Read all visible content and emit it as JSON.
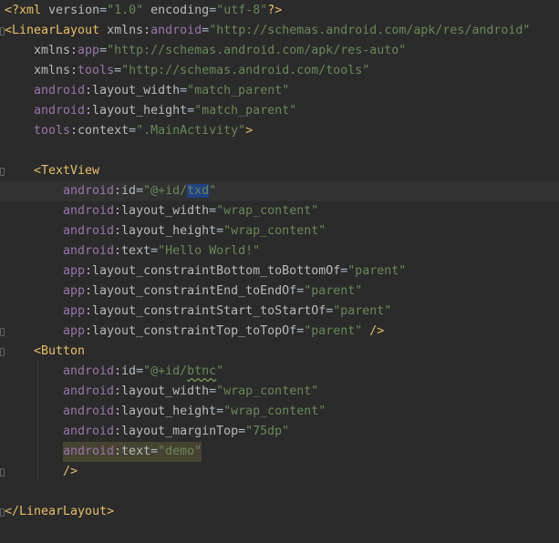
{
  "lines": [
    {
      "indent": 0,
      "tokens": [
        {
          "t": "<?",
          "k": "punc"
        },
        {
          "t": "xml ",
          "k": "tag"
        },
        {
          "t": "version",
          "k": "attr"
        },
        {
          "t": "=",
          "k": "eq"
        },
        {
          "t": "\"1.0\"",
          "k": "str"
        },
        {
          "t": " encoding",
          "k": "attr"
        },
        {
          "t": "=",
          "k": "eq"
        },
        {
          "t": "\"utf-8\"",
          "k": "str"
        },
        {
          "t": "?>",
          "k": "punc"
        }
      ]
    },
    {
      "indent": 0,
      "fold": true,
      "tokens": [
        {
          "t": "<LinearLayout ",
          "k": "tag"
        },
        {
          "t": "xmlns",
          "k": "attr"
        },
        {
          "t": ":",
          "k": "attr"
        },
        {
          "t": "android",
          "k": "ns"
        },
        {
          "t": "=",
          "k": "eq"
        },
        {
          "t": "\"http://schemas.android.com/apk/res/android\"",
          "k": "str"
        }
      ]
    },
    {
      "indent": 1,
      "tokens": [
        {
          "t": "xmlns",
          "k": "attr"
        },
        {
          "t": ":",
          "k": "attr"
        },
        {
          "t": "app",
          "k": "ns"
        },
        {
          "t": "=",
          "k": "eq"
        },
        {
          "t": "\"http://schemas.android.com/apk/res-auto\"",
          "k": "str"
        }
      ]
    },
    {
      "indent": 1,
      "tokens": [
        {
          "t": "xmlns",
          "k": "attr"
        },
        {
          "t": ":",
          "k": "attr"
        },
        {
          "t": "tools",
          "k": "ns"
        },
        {
          "t": "=",
          "k": "eq"
        },
        {
          "t": "\"http://schemas.android.com/tools\"",
          "k": "str"
        }
      ]
    },
    {
      "indent": 1,
      "tokens": [
        {
          "t": "android",
          "k": "ns"
        },
        {
          "t": ":layout_width",
          "k": "attr"
        },
        {
          "t": "=",
          "k": "eq"
        },
        {
          "t": "\"match_parent\"",
          "k": "str"
        }
      ]
    },
    {
      "indent": 1,
      "tokens": [
        {
          "t": "android",
          "k": "ns"
        },
        {
          "t": ":layout_height",
          "k": "attr"
        },
        {
          "t": "=",
          "k": "eq"
        },
        {
          "t": "\"match_parent\"",
          "k": "str"
        }
      ]
    },
    {
      "indent": 1,
      "tokens": [
        {
          "t": "tools",
          "k": "ns"
        },
        {
          "t": ":context",
          "k": "attr"
        },
        {
          "t": "=",
          "k": "eq"
        },
        {
          "t": "\".MainActivity\"",
          "k": "str"
        },
        {
          "t": ">",
          "k": "tag"
        }
      ]
    },
    {
      "indent": 0,
      "tokens": []
    },
    {
      "indent": 1,
      "fold": true,
      "tokens": [
        {
          "t": "<TextView",
          "k": "tag"
        }
      ]
    },
    {
      "indent": 2,
      "current": true,
      "tokens": [
        {
          "t": "android",
          "k": "ns"
        },
        {
          "t": ":id",
          "k": "attr"
        },
        {
          "t": "=",
          "k": "eq"
        },
        {
          "t": "\"@+id/",
          "k": "str"
        },
        {
          "t": "txd",
          "k": "str",
          "sel": true
        },
        {
          "t": "\"",
          "k": "str"
        }
      ]
    },
    {
      "indent": 2,
      "tokens": [
        {
          "t": "android",
          "k": "ns"
        },
        {
          "t": ":layout_width",
          "k": "attr"
        },
        {
          "t": "=",
          "k": "eq"
        },
        {
          "t": "\"wrap_content\"",
          "k": "str"
        }
      ]
    },
    {
      "indent": 2,
      "tokens": [
        {
          "t": "android",
          "k": "ns"
        },
        {
          "t": ":layout_height",
          "k": "attr"
        },
        {
          "t": "=",
          "k": "eq"
        },
        {
          "t": "\"wrap_content\"",
          "k": "str"
        }
      ]
    },
    {
      "indent": 2,
      "tokens": [
        {
          "t": "android",
          "k": "ns"
        },
        {
          "t": ":text",
          "k": "attr"
        },
        {
          "t": "=",
          "k": "eq"
        },
        {
          "t": "\"Hello World!\"",
          "k": "str"
        }
      ]
    },
    {
      "indent": 2,
      "tokens": [
        {
          "t": "app",
          "k": "ns"
        },
        {
          "t": ":layout_constraintBottom_toBottomOf",
          "k": "attr"
        },
        {
          "t": "=",
          "k": "eq"
        },
        {
          "t": "\"parent\"",
          "k": "str"
        }
      ]
    },
    {
      "indent": 2,
      "tokens": [
        {
          "t": "app",
          "k": "ns"
        },
        {
          "t": ":layout_constraintEnd_toEndOf",
          "k": "attr"
        },
        {
          "t": "=",
          "k": "eq"
        },
        {
          "t": "\"parent\"",
          "k": "str"
        }
      ]
    },
    {
      "indent": 2,
      "tokens": [
        {
          "t": "app",
          "k": "ns"
        },
        {
          "t": ":layout_constraintStart_toStartOf",
          "k": "attr"
        },
        {
          "t": "=",
          "k": "eq"
        },
        {
          "t": "\"parent\"",
          "k": "str"
        }
      ]
    },
    {
      "indent": 2,
      "fold": true,
      "tokens": [
        {
          "t": "app",
          "k": "ns"
        },
        {
          "t": ":layout_constraintTop_toTopOf",
          "k": "attr"
        },
        {
          "t": "=",
          "k": "eq"
        },
        {
          "t": "\"parent\"",
          "k": "str"
        },
        {
          "t": " />",
          "k": "tag"
        }
      ]
    },
    {
      "indent": 1,
      "fold": true,
      "tokens": [
        {
          "t": "<Button",
          "k": "tag"
        }
      ]
    },
    {
      "indent": 2,
      "tokens": [
        {
          "t": "android",
          "k": "ns"
        },
        {
          "t": ":id",
          "k": "attr"
        },
        {
          "t": "=",
          "k": "eq"
        },
        {
          "t": "\"@+id/",
          "k": "str"
        },
        {
          "t": "btnc",
          "k": "str",
          "typo": true
        },
        {
          "t": "\"",
          "k": "str"
        }
      ]
    },
    {
      "indent": 2,
      "tokens": [
        {
          "t": "android",
          "k": "ns"
        },
        {
          "t": ":layout_width",
          "k": "attr"
        },
        {
          "t": "=",
          "k": "eq"
        },
        {
          "t": "\"wrap_content\"",
          "k": "str"
        }
      ]
    },
    {
      "indent": 2,
      "tokens": [
        {
          "t": "android",
          "k": "ns"
        },
        {
          "t": ":layout_height",
          "k": "attr"
        },
        {
          "t": "=",
          "k": "eq"
        },
        {
          "t": "\"wrap_content\"",
          "k": "str"
        }
      ]
    },
    {
      "indent": 2,
      "tokens": [
        {
          "t": "android",
          "k": "ns"
        },
        {
          "t": ":layout_marginTop",
          "k": "attr"
        },
        {
          "t": "=",
          "k": "eq"
        },
        {
          "t": "\"75dp\"",
          "k": "str"
        }
      ]
    },
    {
      "indent": 2,
      "warn": true,
      "tokens": [
        {
          "t": "android",
          "k": "ns"
        },
        {
          "t": ":text",
          "k": "attr"
        },
        {
          "t": "=",
          "k": "eq"
        },
        {
          "t": "\"demo\"",
          "k": "str"
        }
      ]
    },
    {
      "indent": 2,
      "fold": true,
      "tokens": [
        {
          "t": "/>",
          "k": "tag"
        }
      ]
    },
    {
      "indent": 0,
      "tokens": []
    },
    {
      "indent": 0,
      "fold": true,
      "tokens": [
        {
          "t": "</LinearLayout>",
          "k": "tag"
        }
      ]
    }
  ]
}
